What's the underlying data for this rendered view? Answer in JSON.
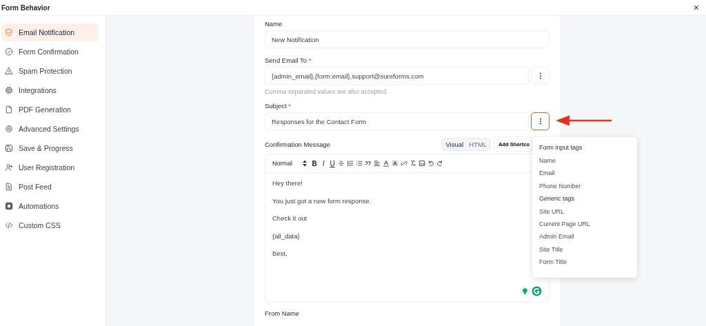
{
  "window": {
    "title": "Form Behavior",
    "close": "×"
  },
  "sidebar": {
    "items": [
      {
        "label": "Email Notification",
        "selected": true
      },
      {
        "label": "Form Confirmation",
        "selected": false
      },
      {
        "label": "Spam Protection",
        "selected": false
      },
      {
        "label": "Integrations",
        "selected": false
      },
      {
        "label": "PDF Generation",
        "selected": false
      },
      {
        "label": "Advanced Settings",
        "selected": false
      },
      {
        "label": "Save & Progress",
        "selected": false
      },
      {
        "label": "User Registration",
        "selected": false
      },
      {
        "label": "Post Feed",
        "selected": false
      },
      {
        "label": "Automations",
        "selected": false
      },
      {
        "label": "Custom CSS",
        "selected": false
      }
    ]
  },
  "form": {
    "name": {
      "label": "Name",
      "value": "New Notification"
    },
    "send_email_to": {
      "label": "Send Email To",
      "required_mark": "*",
      "value": "{admin_email},{form:email},support@sureforms.com",
      "hint": "Comma separated values are also accepted."
    },
    "subject": {
      "label": "Subject",
      "required_mark": "*",
      "value": "Responses for the Contact Form"
    },
    "confirmation_message": {
      "label": "Confirmation Message",
      "modes": [
        {
          "label": "Visual",
          "selected": true
        },
        {
          "label": "HTML",
          "selected": false
        }
      ],
      "add_shortcode": "Add Shortco",
      "format_select": "Normal",
      "toolbar_letters": [
        "B",
        "I",
        "U"
      ],
      "lines": [
        "Hey there!",
        "You just got a new form response.",
        "Check it out",
        "{all_data}",
        "Best,"
      ]
    },
    "from_name": {
      "label": "From Name"
    }
  },
  "tags_menu": {
    "sections": [
      {
        "heading": "Form input tags",
        "items": [
          "Name",
          "Email",
          "Phone Number"
        ]
      },
      {
        "heading": "Generic tags",
        "items": [
          "Site URL",
          "Current Page URL",
          "Admin Email",
          "Site Title",
          "Form Title"
        ]
      }
    ]
  }
}
